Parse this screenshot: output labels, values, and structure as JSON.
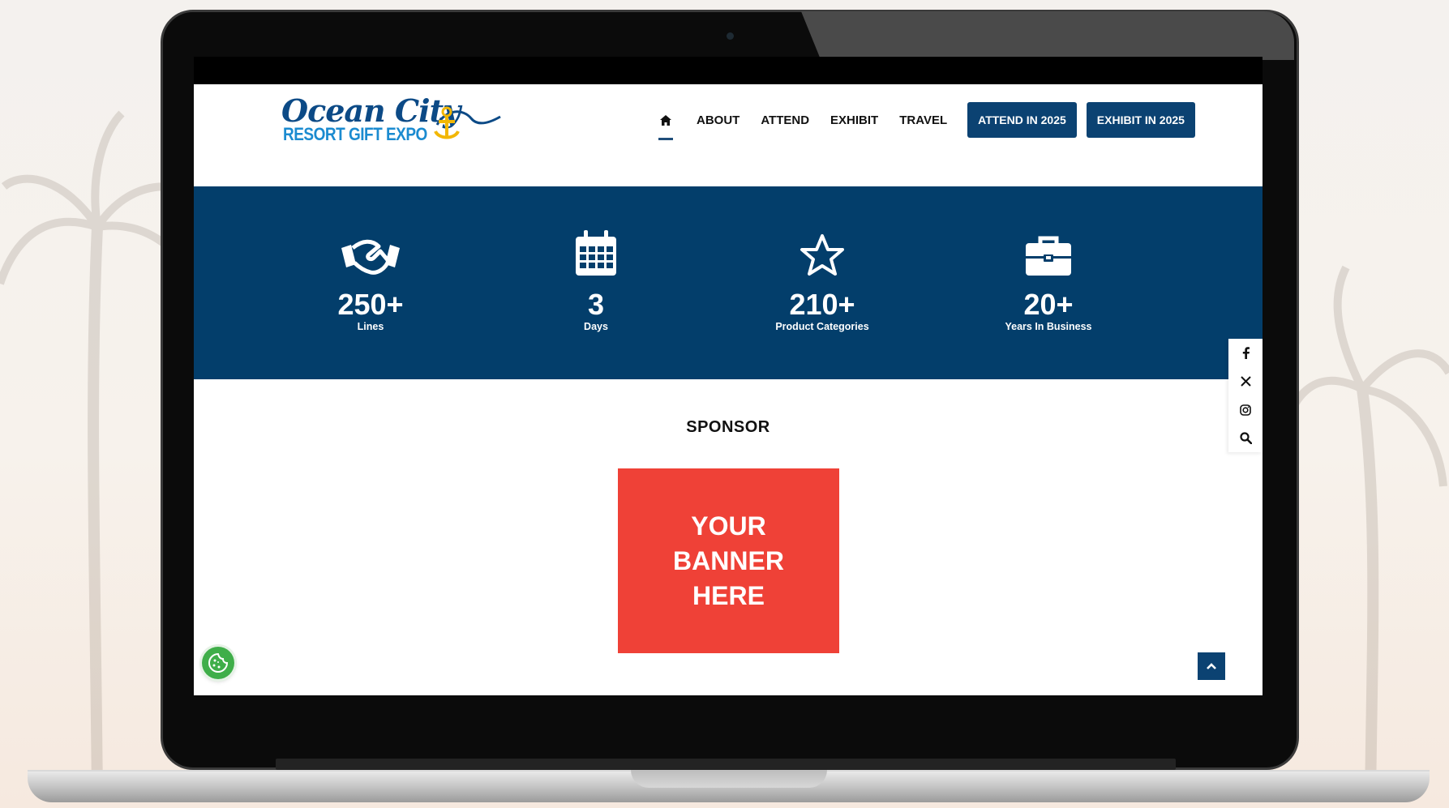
{
  "header": {
    "logo": {
      "script": "Ocean City",
      "subtitle": "RESORT GIFT EXPO"
    },
    "nav": {
      "home_icon": "home-icon",
      "links": [
        "ABOUT",
        "ATTEND",
        "EXHIBIT",
        "TRAVEL"
      ],
      "buttons": [
        "ATTEND IN 2025",
        "EXHIBIT IN 2025"
      ]
    }
  },
  "stats": [
    {
      "icon": "handshake-icon",
      "value": "250+",
      "label": "Lines"
    },
    {
      "icon": "calendar-icon",
      "value": "3",
      "label": "Days"
    },
    {
      "icon": "star-icon",
      "value": "210+",
      "label": "Product Categories"
    },
    {
      "icon": "briefcase-icon",
      "value": "20+",
      "label": "Years In Business"
    }
  ],
  "social": [
    "facebook-icon",
    "x-icon",
    "instagram-icon",
    "search-icon"
  ],
  "sponsor": {
    "title": "SPONSOR",
    "banner_lines": [
      "YOUR",
      "BANNER",
      "HERE"
    ]
  },
  "colors": {
    "brand_navy": "#033e6b",
    "button_navy": "#0b4272",
    "banner_red": "#ef4137",
    "cookie_green": "#3fae49"
  },
  "widgets": {
    "cookie": "cookie-icon",
    "scroll_top": "chevron-up-icon"
  }
}
